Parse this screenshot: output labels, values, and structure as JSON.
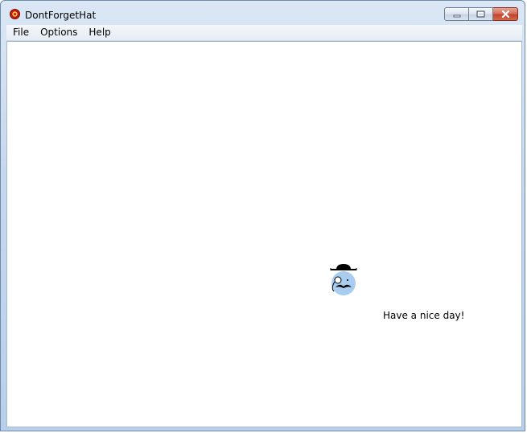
{
  "window": {
    "title": "DontForgetHat",
    "app_icon": "red-circle-app-icon",
    "caption_buttons": [
      "minimize-icon",
      "maximize-icon",
      "close-icon"
    ]
  },
  "menu": {
    "items": [
      "File",
      "Options",
      "Help"
    ]
  },
  "content": {
    "figure_icon": "hat-mustache-face-icon",
    "message": "Have a nice day!"
  },
  "colors": {
    "face": "#a9cdf0",
    "close_button": "#c2452b"
  }
}
